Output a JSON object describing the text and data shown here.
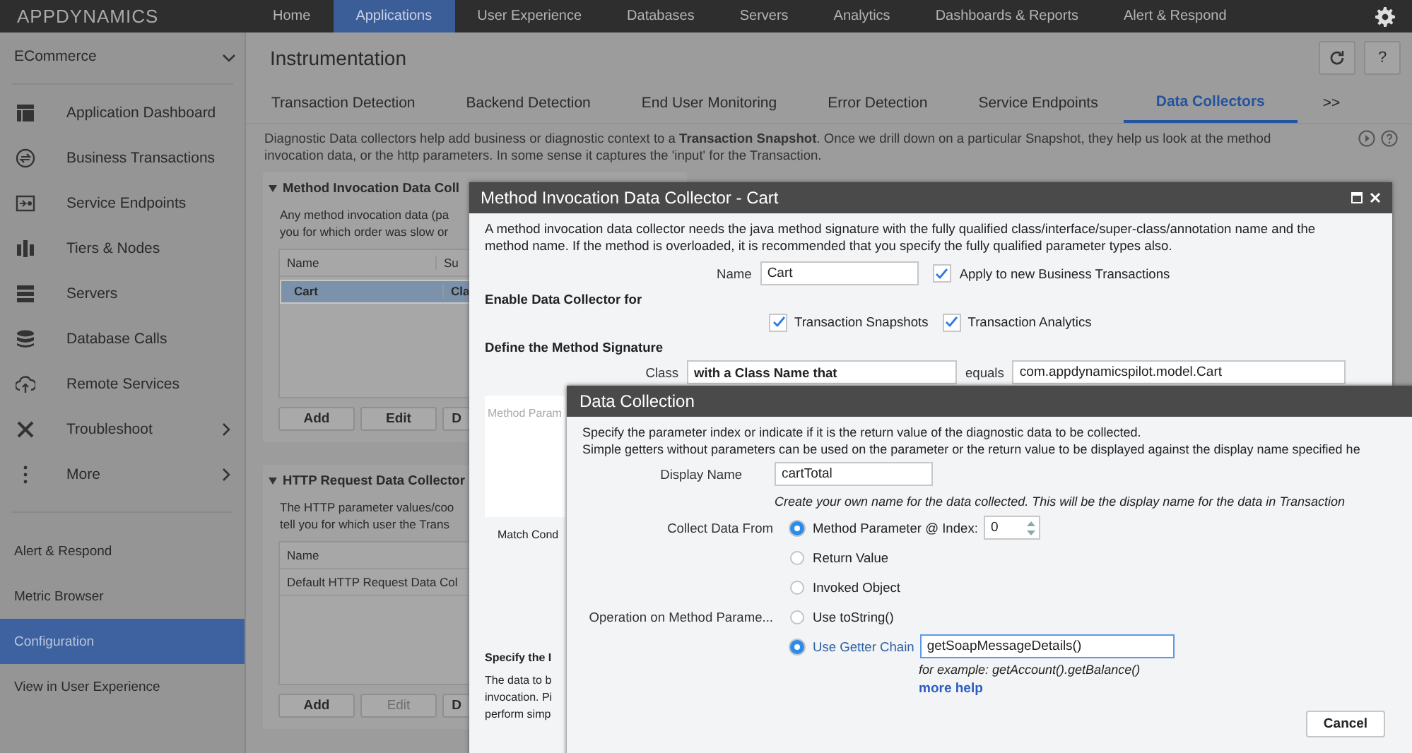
{
  "top_nav": {
    "logo": "APPDYNAMICS",
    "items": [
      {
        "label": "Home",
        "selected": false
      },
      {
        "label": "Applications",
        "selected": true
      },
      {
        "label": "User Experience",
        "selected": false
      },
      {
        "label": "Databases",
        "selected": false
      },
      {
        "label": "Servers",
        "selected": false
      },
      {
        "label": "Analytics",
        "selected": false
      },
      {
        "label": "Dashboards & Reports",
        "selected": false
      },
      {
        "label": "Alert & Respond",
        "selected": false
      }
    ]
  },
  "sidebar": {
    "app_selector": "ECommerce",
    "items": [
      {
        "label": "Application Dashboard",
        "has_submenu": false
      },
      {
        "label": "Business Transactions",
        "has_submenu": false
      },
      {
        "label": "Service Endpoints",
        "has_submenu": false
      },
      {
        "label": "Tiers & Nodes",
        "has_submenu": false
      },
      {
        "label": "Servers",
        "has_submenu": false
      },
      {
        "label": "Database Calls",
        "has_submenu": false
      },
      {
        "label": "Remote Services",
        "has_submenu": false
      },
      {
        "label": "Troubleshoot",
        "has_submenu": true
      },
      {
        "label": "More",
        "has_submenu": true
      }
    ],
    "links": [
      {
        "label": "Alert & Respond",
        "selected": false
      },
      {
        "label": "Metric Browser",
        "selected": false
      },
      {
        "label": "Configuration",
        "selected": true
      },
      {
        "label": "View in User Experience",
        "selected": false
      }
    ]
  },
  "page": {
    "title": "Instrumentation",
    "help_label": "?",
    "tabs": [
      {
        "label": "Transaction Detection",
        "selected": false
      },
      {
        "label": "Backend Detection",
        "selected": false
      },
      {
        "label": "End User Monitoring",
        "selected": false
      },
      {
        "label": "Error Detection",
        "selected": false
      },
      {
        "label": "Service Endpoints",
        "selected": false
      },
      {
        "label": "Data Collectors",
        "selected": true
      }
    ],
    "more_tabs": ">>",
    "description_lines": [
      "Diagnostic Data collectors help add business or diagnostic context to a **Transaction Snapshot**. Once we drill down on a particular Snapshot, they help us look at the method",
      "invocation data, or the http parameters.  In some sense it captures the 'input' for the Transaction."
    ]
  },
  "sections": [
    {
      "heading": "Method Invocation Data Coll",
      "text_lines": [
        "Any method invocation data (pa",
        "you for which order was slow or"
      ],
      "columns": [
        "Name",
        "Su"
      ],
      "rows": [
        {
          "cells": [
            "Cart",
            "Cla"
          ],
          "selected": true
        }
      ],
      "buttons": [
        {
          "label": "Add",
          "disabled": false
        },
        {
          "label": "Edit",
          "disabled": false
        },
        {
          "label": "D",
          "disabled": false
        }
      ]
    },
    {
      "heading": "HTTP Request Data Collector",
      "text_lines": [
        "The HTTP parameter values/coo",
        "tell you for which user the Trans"
      ],
      "columns": [
        "Name"
      ],
      "rows": [
        {
          "cells": [
            "Default HTTP Request Data Col"
          ],
          "selected": false
        }
      ],
      "buttons": [
        {
          "label": "Add",
          "disabled": false
        },
        {
          "label": "Edit",
          "disabled": true
        },
        {
          "label": "D",
          "disabled": false
        }
      ]
    }
  ],
  "method_dialog": {
    "title": "Method Invocation Data Collector - Cart",
    "description_lines": [
      "A method invocation data collector needs the java method signature with the fully qualified class/interface/super-class/annotation name and the",
      "method name. If the method is overloaded, it is recommended that you specify the fully qualified parameter types also."
    ],
    "name_label": "Name",
    "name_value": "Cart",
    "apply_checkbox": {
      "label": "Apply to new Business Transactions",
      "checked": true
    },
    "enable_heading": "Enable Data Collector for",
    "enable_checkboxes": [
      {
        "label": "Transaction Snapshots",
        "checked": true
      },
      {
        "label": "Transaction Analytics",
        "checked": true
      }
    ],
    "signature_heading": "Define the Method Signature",
    "class_label": "Class",
    "class_select": "with a Class Name that",
    "equals_label": "equals",
    "class_value": "com.appdynamicspilot.model.Cart",
    "params_placeholder": "Method Param",
    "match_label": "Match Cond",
    "specify_heading": "Specify the I",
    "specify_lines": [
      "The data to b",
      "invocation. Pi",
      "perform simp"
    ]
  },
  "data_dialog": {
    "title": "Data Collection",
    "description_lines": [
      "Specify the parameter index or indicate if it is the return value of the diagnostic data to be collected.",
      "Simple getters without parameters can be used on the parameter or the return value to be displayed against the display name specified he"
    ],
    "display_name_label": "Display Name",
    "display_name_value": "cartTotal",
    "display_name_hint": "Create your own name for the data collected.  This will be the display name for the data in Transaction",
    "collect_label": "Collect Data From",
    "collect_options": [
      {
        "label": "Method Parameter @ Index:",
        "selected": true
      },
      {
        "label": "Return Value",
        "selected": false
      },
      {
        "label": "Invoked Object",
        "selected": false
      }
    ],
    "index_value": "0",
    "operation_label": "Operation on Method Parame...",
    "operation_options": [
      {
        "label": "Use toString()",
        "selected": false
      },
      {
        "label": "Use Getter Chain",
        "selected": true
      }
    ],
    "getter_value": "getSoapMessageDetails()",
    "example": "for example: getAccount().getBalance()",
    "help_link": "more help",
    "buttons": [
      "Cancel"
    ]
  }
}
